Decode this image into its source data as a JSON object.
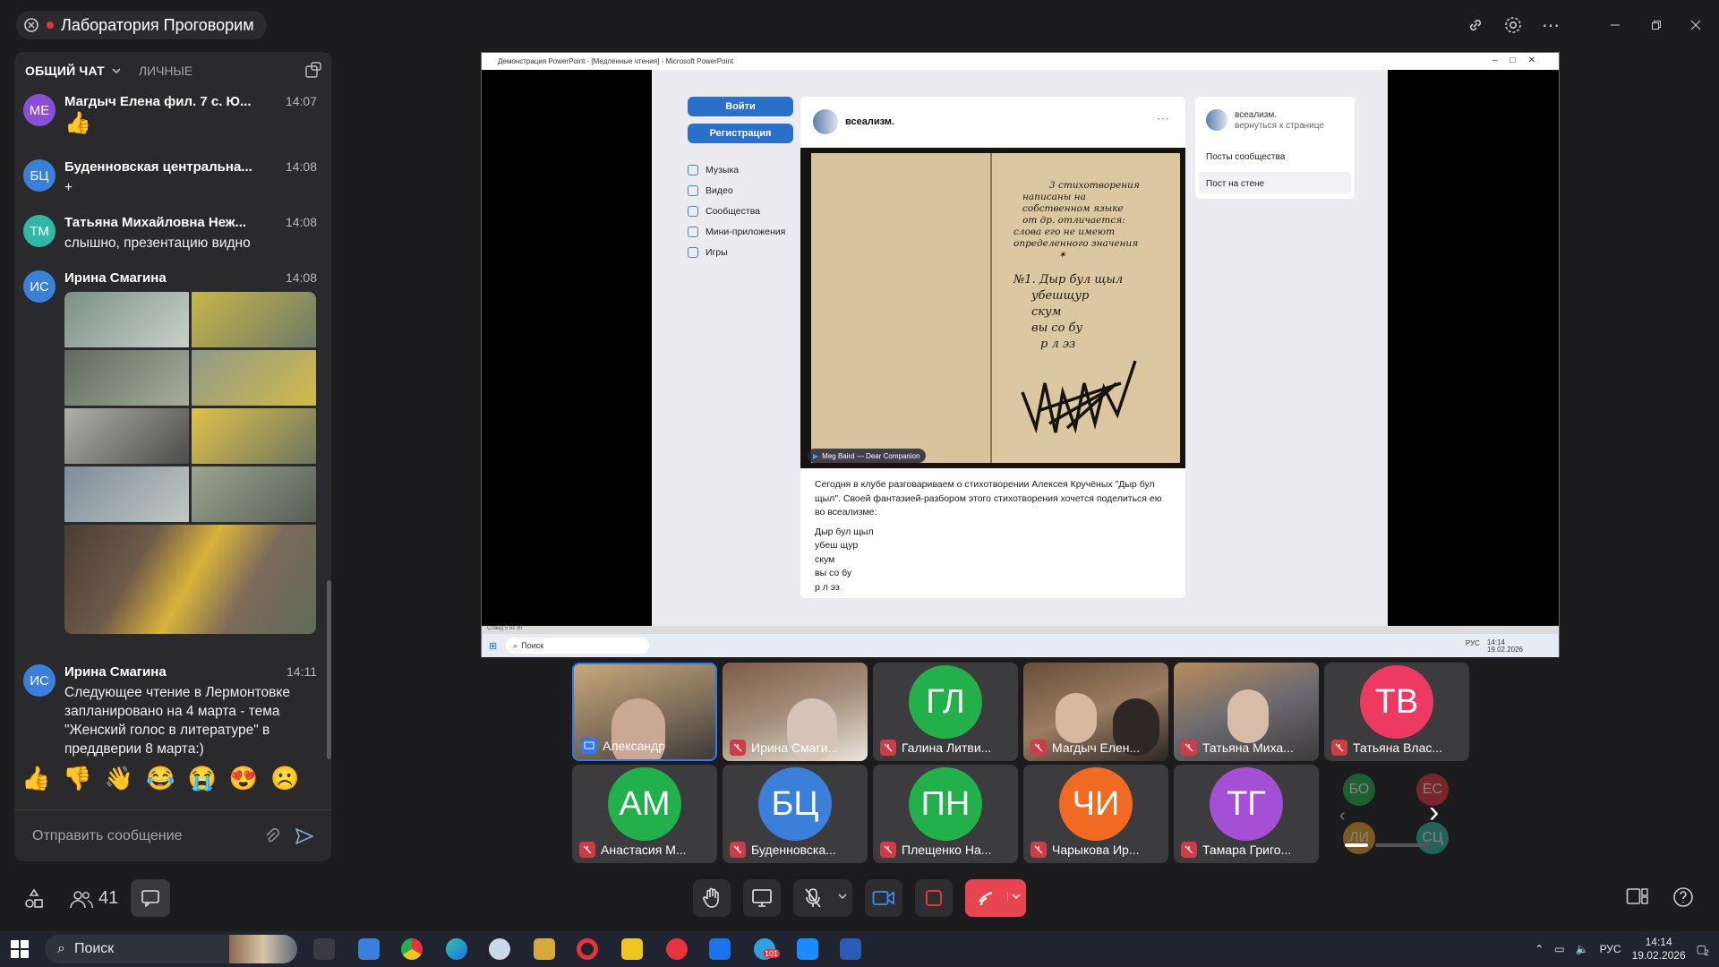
{
  "window": {
    "title": "Лаборатория Проговорим"
  },
  "chat": {
    "tab_general": "ОБЩИЙ ЧАТ",
    "tab_private": "ЛИЧНЫЕ",
    "messages": [
      {
        "initials": "МЕ",
        "color": "#8a4fd6",
        "name": "Магдыч Елена фил. 7 с. Ю...",
        "time": "14:07",
        "text": "👍"
      },
      {
        "initials": "БЦ",
        "color": "#3a7fd9",
        "name": "Буденновская центральна...",
        "time": "14:08",
        "text": "+"
      },
      {
        "initials": "ТМ",
        "color": "#2eb8a6",
        "name": "Татьяна Михайловна Неж...",
        "time": "14:08",
        "text": "слышно, презентацию видно"
      },
      {
        "initials": "ИС",
        "color": "#3a7fd9",
        "name": "Ирина Смагина",
        "time": "14:08",
        "text": ""
      },
      {
        "initials": "ИС",
        "color": "#3a7fd9",
        "name": "Ирина Смагина",
        "time": "14:11",
        "text": "Следующее чтение в Лермонтовке запланировано на 4 марта - тема \"Женский голос в литературе\" в преддверии 8 марта:)"
      }
    ],
    "reactions": [
      "👍",
      "👎",
      "👋",
      "😂",
      "😭",
      "😍",
      "☹️"
    ],
    "input_placeholder": "Отправить сообщение"
  },
  "participants_count": "41",
  "screen": {
    "ppt_title": "Демонстрация PowerPoint - [Медленные чтения] - Microsoft PowerPoint",
    "slide_status": "Слайд 5 из 30",
    "vk": {
      "login": "Войти",
      "register": "Регистрация",
      "menu": [
        "Музыка",
        "Видео",
        "Сообщества",
        "Мини-приложения",
        "Игры"
      ],
      "group_name": "всеализм.",
      "group_sub": "вернуться к странице",
      "right_links": [
        "Посты сообщества",
        "Пост на стене"
      ],
      "audio_label": "Meg Baird — Dear Companion",
      "manuscript": [
        "3 стихотворения",
        "написаны на",
        "собственном языке",
        "от др. отличается:",
        "слова его не имеют",
        "определенного значения",
        "✶",
        "№1. Дыр бул щыл",
        "убешщур",
        "скум",
        "вы со бу",
        "р л эз"
      ],
      "post_text": "Сегодня в клубе разговариваем о стихотворении Алексея Кручёных \"Дыр бул щыл\". Своей фантазией-разбором этого стихотворения хочется поделиться ею во всеализме:",
      "poem": [
        "Дыр бул щыл",
        "убеш щур",
        "скум",
        "вы со бу",
        "р л эз"
      ]
    },
    "mini_taskbar": {
      "search": "Поиск",
      "lang": "РУС",
      "time": "14:14",
      "date": "19.02.2026"
    }
  },
  "tiles": [
    {
      "name": "Александр",
      "type": "video",
      "muted": false,
      "active": true
    },
    {
      "name": "Ирина Смаги...",
      "type": "video",
      "muted": true
    },
    {
      "name": "Галина Литви...",
      "initials": "ГЛ",
      "color": "#22b04a",
      "muted": true
    },
    {
      "name": "Магдыч Елен...",
      "type": "video",
      "muted": true
    },
    {
      "name": "Татьяна Миха...",
      "type": "video",
      "muted": true
    },
    {
      "name": "Татьяна Влас...",
      "initials": "ТВ",
      "color": "#ec3a63",
      "muted": true
    },
    {
      "name": "Анастасия М...",
      "initials": "АМ",
      "color": "#22b04a",
      "muted": true
    },
    {
      "name": "Буденновска...",
      "initials": "БЦ",
      "color": "#3a7fd9",
      "muted": true
    },
    {
      "name": "Плещенко На...",
      "initials": "ПН",
      "color": "#22b04a",
      "muted": true
    },
    {
      "name": "Чарыкова Ир...",
      "initials": "ЧИ",
      "color": "#f06a22",
      "muted": true
    },
    {
      "name": "Тамара Григо...",
      "initials": "ТГ",
      "color": "#a54fd6",
      "muted": true
    }
  ],
  "more_avatars": [
    {
      "initials": "БО",
      "color": "#22b04a"
    },
    {
      "initials": "ЕС",
      "color": "#e8333a"
    },
    {
      "initials": "ЛИ",
      "color": "#f0a422"
    },
    {
      "initials": "СЦ",
      "color": "#2eb8a6"
    }
  ],
  "taskbar": {
    "search": "Поиск",
    "lang": "РУС",
    "time": "14:14",
    "date": "19.02.2026",
    "badge": "101",
    "notif": "2"
  }
}
